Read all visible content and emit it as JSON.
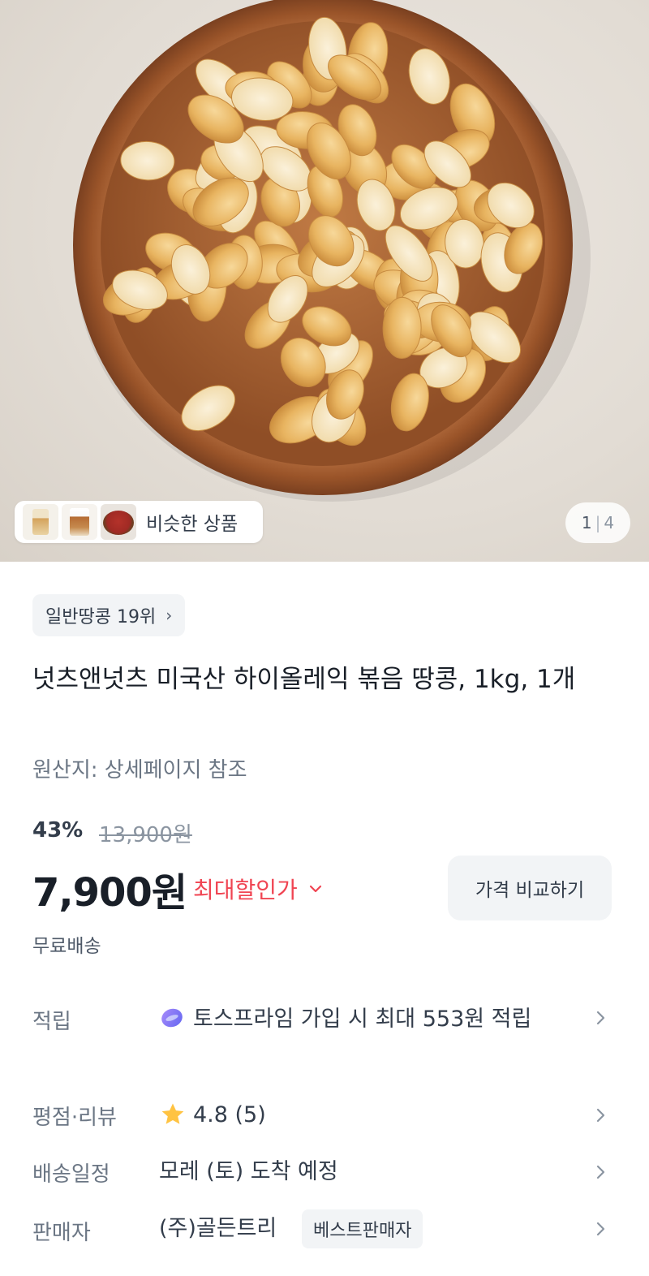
{
  "hero": {
    "similar_label": "비슷한 상품",
    "page_current": "1",
    "page_total": "4",
    "image_subject": "roasted peanuts in wooden bowl"
  },
  "product": {
    "rank_label": "일반땅콩 19위",
    "title": "넛츠앤넛츠 미국산 하이올레익 볶음 땅콩, 1kg, 1개",
    "origin": "원산지: 상세페이지 참조",
    "discount_rate": "43%",
    "original_price": "13,900원",
    "price": "7,900원",
    "max_discount_label": "최대할인가",
    "compare_button": "가격 비교하기",
    "shipping": "무료배송"
  },
  "details": {
    "points_label": "적립",
    "points_value": "토스프라임 가입 시 최대 553원 적립",
    "rating_label": "평점·리뷰",
    "rating_value": "4.8 (5)",
    "delivery_label": "배송일정",
    "delivery_value": "모레 (토) 도착 예정",
    "seller_label": "판매자",
    "seller_value": "(주)골든트리",
    "seller_badge": "베스트판매자"
  },
  "colors": {
    "accent_red": "#f04452",
    "star": "#ffc342",
    "text_primary": "#191f28",
    "text_secondary": "#6b7684"
  }
}
